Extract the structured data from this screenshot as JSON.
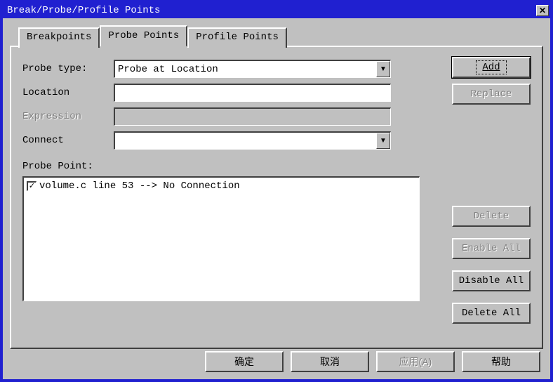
{
  "title": "Break/Probe/Profile Points",
  "tabs": {
    "breakpoints": "Breakpoints",
    "probe": "Probe Points",
    "profile": "Profile Points"
  },
  "form": {
    "probe_type_label": "Probe type:",
    "probe_type_value": "Probe at Location",
    "location_label": "Location",
    "location_value": "",
    "expression_label": "Expression",
    "expression_value": "",
    "connect_label": "Connect",
    "connect_value": ""
  },
  "buttons": {
    "add": "Add",
    "replace": "Replace",
    "delete": "Delete",
    "enable_all": "Enable All",
    "disable_all": "Disable All",
    "delete_all": "Delete All"
  },
  "list": {
    "label": "Probe Point:",
    "items": [
      {
        "checked": true,
        "text": "volume.c line 53 --> No Connection"
      }
    ]
  },
  "bottom": {
    "ok": "确定",
    "cancel": "取消",
    "apply": "应用(A)",
    "help": "帮助"
  }
}
